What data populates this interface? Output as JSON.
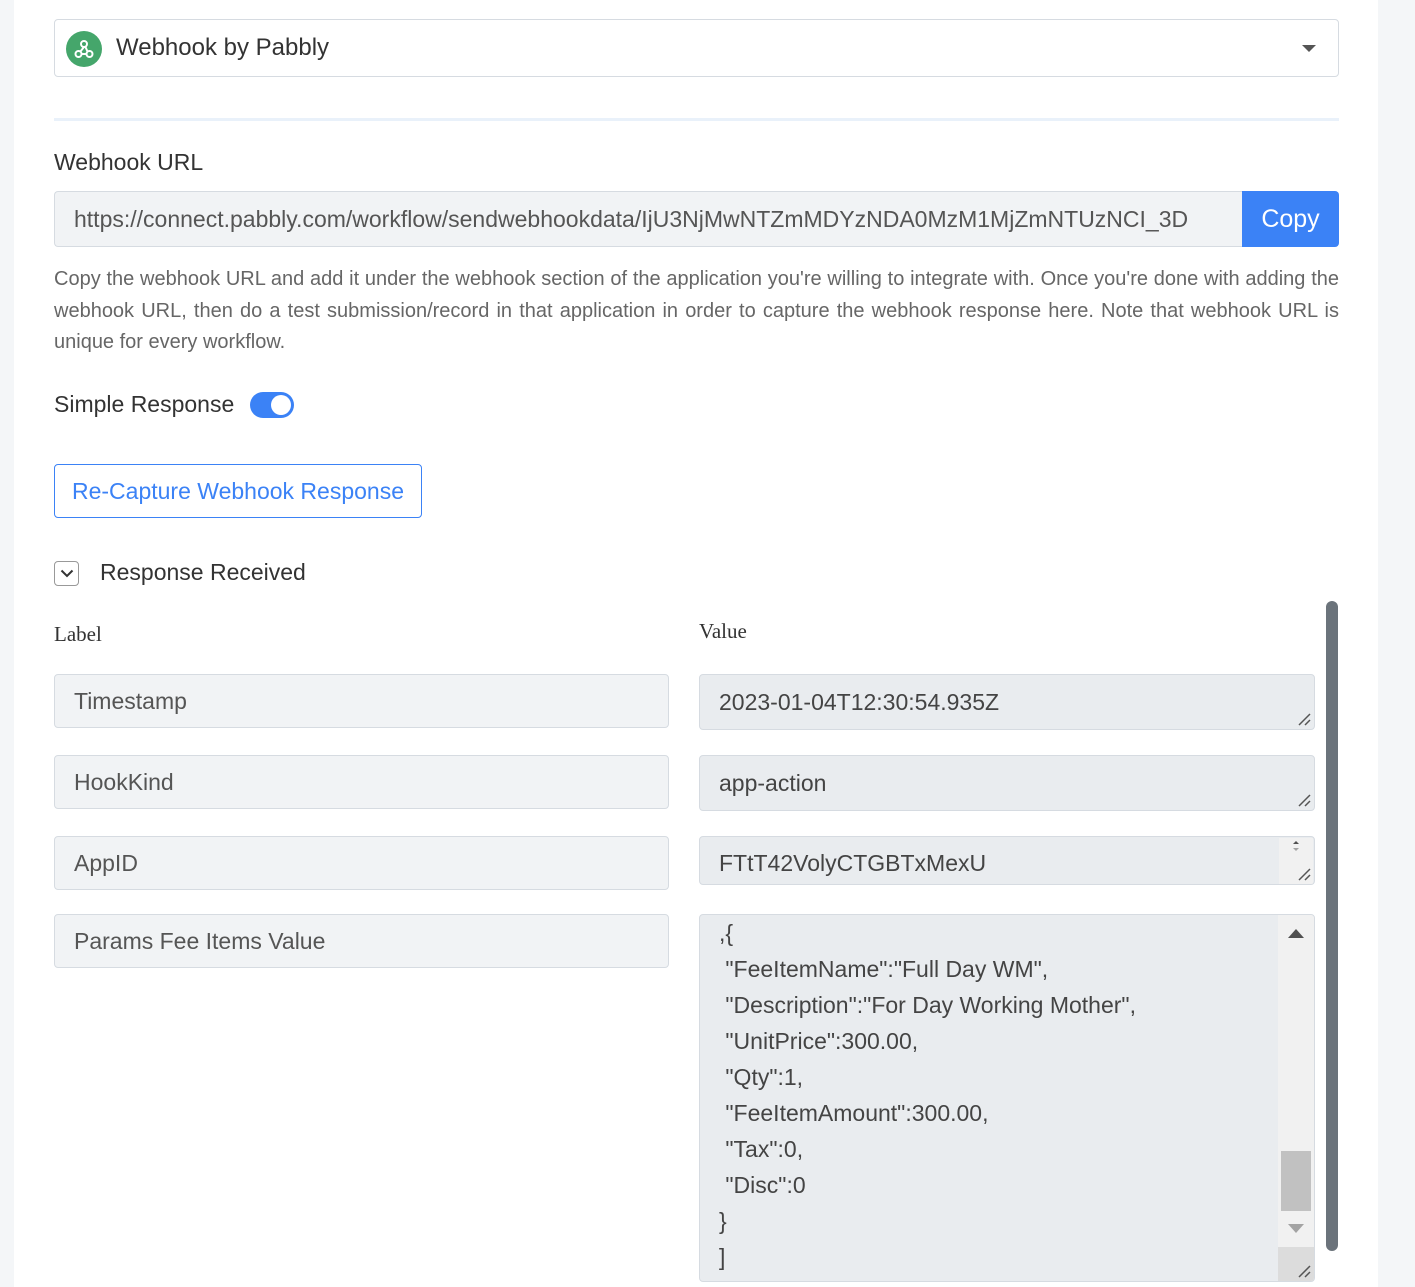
{
  "app_select": {
    "name": "Webhook by Pabbly"
  },
  "webhook": {
    "label": "Webhook URL",
    "url": "https://connect.pabbly.com/workflow/sendwebhookdata/IjU3NjMwNTZmMDYzNDA0MzM1MjZmNTUzNCI_3D",
    "copy_label": "Copy",
    "help": "Copy the webhook URL and add it under the webhook section of the application you're willing to integrate with. Once you're done with adding the webhook URL, then do a test submission/record in that application in order to capture the webhook response here. Note that webhook URL is unique for every workflow."
  },
  "simple_response": {
    "label": "Simple Response",
    "enabled": true
  },
  "recapture_label": "Re-Capture Webhook Response",
  "response": {
    "title": "Response Received",
    "col_label": "Label",
    "col_value": "Value",
    "rows": [
      {
        "label": "Timestamp",
        "value": "2023-01-04T12:30:54.935Z"
      },
      {
        "label": "HookKind",
        "value": "app-action"
      },
      {
        "label": "AppID",
        "value": "FTtT42VolyCTGBTxMexU"
      },
      {
        "label": "Params Fee Items Value",
        "value": ",{\n \"FeeItemName\":\"Full Day WM\",\n \"Description\":\"For Day Working Mother\",\n \"UnitPrice\":300.00,\n \"Qty\":1,\n \"FeeItemAmount\":300.00,\n \"Tax\":0,\n \"Disc\":0\n}\n]"
      }
    ]
  },
  "colors": {
    "accent": "#3b82f6",
    "logo": "#45a66b"
  },
  "icons": {
    "app": "webhook-icon",
    "dropdown": "caret-down-icon",
    "collapse": "chevron-down-icon",
    "resize": "resize-grip-icon"
  }
}
